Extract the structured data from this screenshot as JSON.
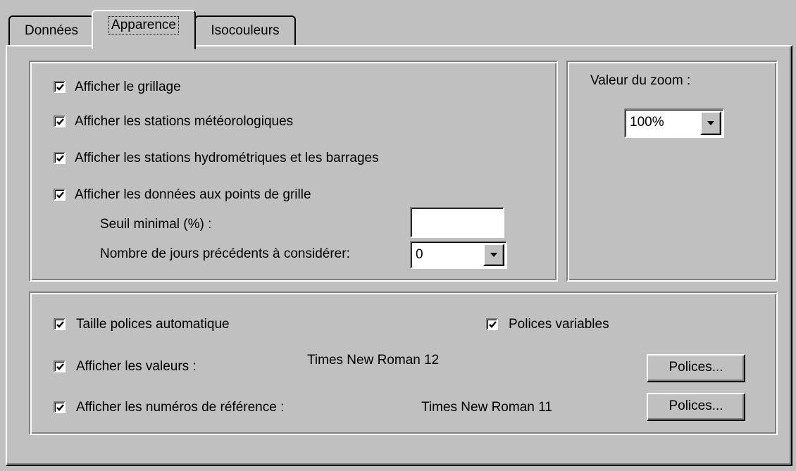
{
  "tabs": [
    {
      "label": "Données",
      "active": false
    },
    {
      "label": "Apparence",
      "active": true
    },
    {
      "label": "Isocouleurs",
      "active": false
    }
  ],
  "display_options": {
    "show_grid": {
      "label": "Afficher le grillage",
      "checked": true
    },
    "show_weather_stations": {
      "label": "Afficher les stations météorologiques",
      "checked": true
    },
    "show_hydro_stations": {
      "label": "Afficher les stations hydrométriques et les barrages",
      "checked": true
    },
    "show_grid_data": {
      "label": "Afficher les données aux points de grille",
      "checked": true
    },
    "min_threshold": {
      "label": "Seuil minimal (%) :",
      "value": ""
    },
    "previous_days": {
      "label": "Nombre de jours précédents à considérer:",
      "value": "0"
    }
  },
  "zoom": {
    "label": "Valeur du zoom :",
    "value": "100%"
  },
  "fonts": {
    "auto_font_size": {
      "label": "Taille polices automatique",
      "checked": true
    },
    "variable_fonts": {
      "label": "Polices variables",
      "checked": true
    },
    "show_values": {
      "label": "Afficher les valeurs :",
      "checked": true,
      "font": "Times New Roman 12",
      "button": "Polices..."
    },
    "show_reference_numbers": {
      "label": "Afficher les numéros de référence :",
      "checked": true,
      "font": "Times New Roman 11",
      "button": "Polices..."
    }
  }
}
